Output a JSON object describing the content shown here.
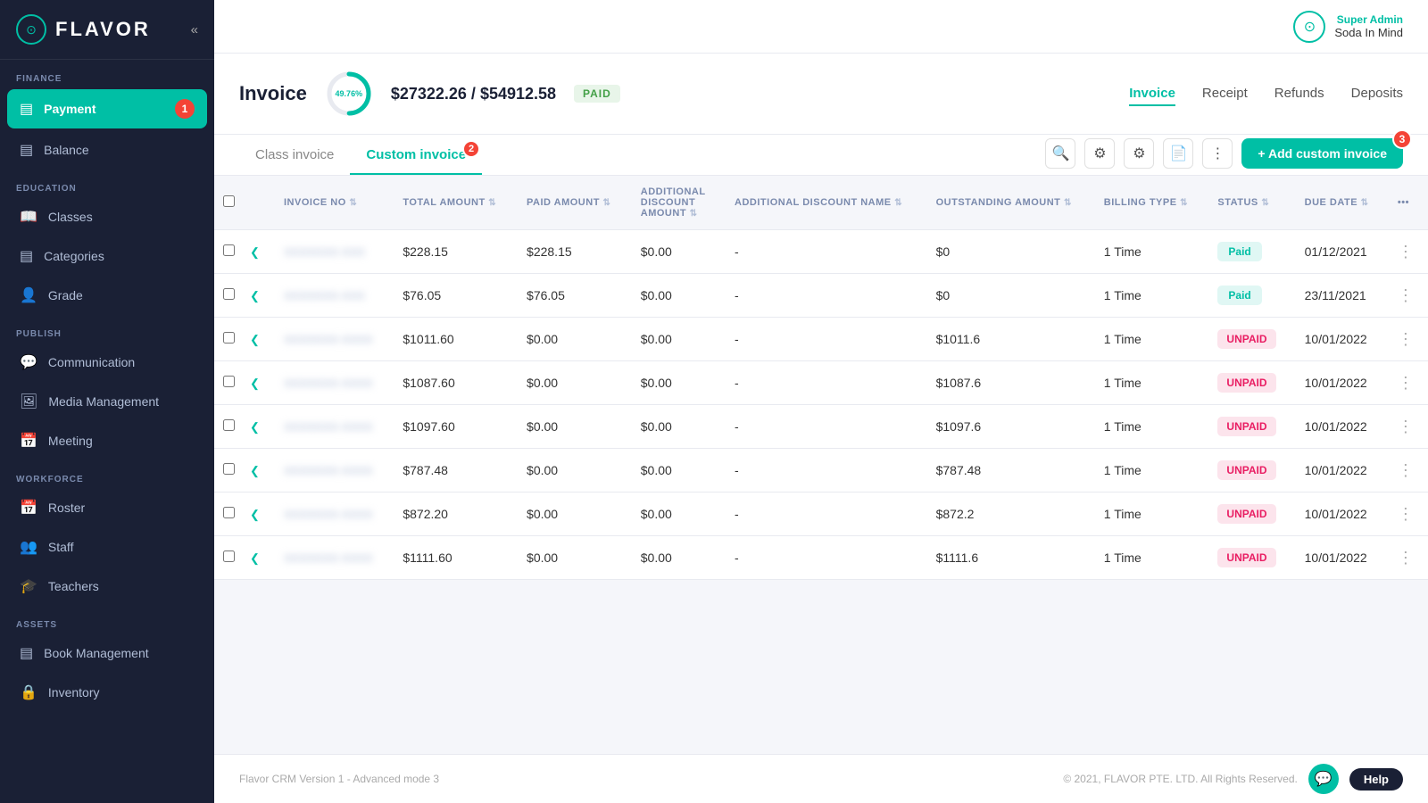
{
  "app": {
    "logo_text": "FLAVOR",
    "chevron": "«"
  },
  "topbar": {
    "role": "Super Admin",
    "name": "Soda In Mind",
    "avatar_icon": "⊙"
  },
  "sidebar": {
    "sections": [
      {
        "label": "FINANCE",
        "items": [
          {
            "id": "payment",
            "icon": "▤",
            "label": "Payment",
            "active": true,
            "badge": "1"
          },
          {
            "id": "balance",
            "icon": "▤",
            "label": "Balance",
            "active": false
          }
        ]
      },
      {
        "label": "EDUCATION",
        "items": [
          {
            "id": "classes",
            "icon": "📖",
            "label": "Classes",
            "active": false
          },
          {
            "id": "categories",
            "icon": "▤",
            "label": "Categories",
            "active": false
          },
          {
            "id": "grade",
            "icon": "👤",
            "label": "Grade",
            "active": false
          }
        ]
      },
      {
        "label": "PUBLISH",
        "items": [
          {
            "id": "communication",
            "icon": "💬",
            "label": "Communication",
            "active": false
          },
          {
            "id": "media",
            "icon": "🖼",
            "label": "Media Management",
            "active": false
          },
          {
            "id": "meeting",
            "icon": "📅",
            "label": "Meeting",
            "active": false
          }
        ]
      },
      {
        "label": "WORKFORCE",
        "items": [
          {
            "id": "roster",
            "icon": "📅",
            "label": "Roster",
            "active": false
          },
          {
            "id": "staff",
            "icon": "👥",
            "label": "Staff",
            "active": false
          },
          {
            "id": "teachers",
            "icon": "🎓",
            "label": "Teachers",
            "active": false
          }
        ]
      },
      {
        "label": "ASSETS",
        "items": [
          {
            "id": "book",
            "icon": "▤",
            "label": "Book Management",
            "active": false
          },
          {
            "id": "inventory",
            "icon": "🔒",
            "label": "Inventory",
            "active": false
          }
        ]
      }
    ]
  },
  "invoice_header": {
    "title": "Invoice",
    "progress_pct": "49.76%",
    "amount_paid": "$27322.26",
    "amount_total": "$54912.58",
    "status": "PAID",
    "tabs": [
      {
        "id": "invoice",
        "label": "Invoice",
        "active": true
      },
      {
        "id": "receipt",
        "label": "Receipt",
        "active": false
      },
      {
        "id": "refunds",
        "label": "Refunds",
        "active": false
      },
      {
        "id": "deposits",
        "label": "Deposits",
        "active": false
      }
    ]
  },
  "subtabs": {
    "items": [
      {
        "id": "class-invoice",
        "label": "Class invoice",
        "active": false
      },
      {
        "id": "custom-invoice",
        "label": "Custom invoice",
        "active": true
      }
    ],
    "add_button_label": "+ Add custom invoice",
    "badge_subtab": "2",
    "badge_add": "3"
  },
  "table": {
    "columns": [
      {
        "id": "checkbox",
        "label": ""
      },
      {
        "id": "expand",
        "label": ""
      },
      {
        "id": "invoice_no",
        "label": "INVOICE NO"
      },
      {
        "id": "total_amount",
        "label": "TOTAL AMOUNT"
      },
      {
        "id": "paid_amount",
        "label": "PAID AMOUNT"
      },
      {
        "id": "additional_discount_amount",
        "label": "ADDITIONAL DISCOUNT AMOUNT"
      },
      {
        "id": "additional_discount_name",
        "label": "ADDITIONAL DISCOUNT NAME"
      },
      {
        "id": "outstanding_amount",
        "label": "OUTSTANDING AMOUNT"
      },
      {
        "id": "billing_type",
        "label": "BILLING TYPE"
      },
      {
        "id": "status",
        "label": "STATUS"
      },
      {
        "id": "due_date",
        "label": "DUE DATE"
      },
      {
        "id": "actions",
        "label": "•••"
      }
    ],
    "rows": [
      {
        "invoice_no": "XXXXXXX-XXX",
        "total_amount": "$228.15",
        "paid_amount": "$228.15",
        "additional_discount_amount": "$0.00",
        "additional_discount_name": "-",
        "outstanding_amount": "$0",
        "billing_type": "1 Time",
        "status": "Paid",
        "status_type": "paid",
        "due_date": "01/12/2021"
      },
      {
        "invoice_no": "XXXXXXX-XXX",
        "total_amount": "$76.05",
        "paid_amount": "$76.05",
        "additional_discount_amount": "$0.00",
        "additional_discount_name": "-",
        "outstanding_amount": "$0",
        "billing_type": "1 Time",
        "status": "Paid",
        "status_type": "paid",
        "due_date": "23/11/2021"
      },
      {
        "invoice_no": "XXXXXXX-XXXX",
        "total_amount": "$1011.60",
        "paid_amount": "$0.00",
        "additional_discount_amount": "$0.00",
        "additional_discount_name": "-",
        "outstanding_amount": "$1011.6",
        "billing_type": "1 Time",
        "status": "UNPAID",
        "status_type": "unpaid",
        "due_date": "10/01/2022"
      },
      {
        "invoice_no": "XXXXXXX-XXXX",
        "total_amount": "$1087.60",
        "paid_amount": "$0.00",
        "additional_discount_amount": "$0.00",
        "additional_discount_name": "-",
        "outstanding_amount": "$1087.6",
        "billing_type": "1 Time",
        "status": "UNPAID",
        "status_type": "unpaid",
        "due_date": "10/01/2022"
      },
      {
        "invoice_no": "XXXXXXX-XXXX",
        "total_amount": "$1097.60",
        "paid_amount": "$0.00",
        "additional_discount_amount": "$0.00",
        "additional_discount_name": "-",
        "outstanding_amount": "$1097.6",
        "billing_type": "1 Time",
        "status": "UNPAID",
        "status_type": "unpaid",
        "due_date": "10/01/2022"
      },
      {
        "invoice_no": "XXXXXXX-XXXX",
        "total_amount": "$787.48",
        "paid_amount": "$0.00",
        "additional_discount_amount": "$0.00",
        "additional_discount_name": "-",
        "outstanding_amount": "$787.48",
        "billing_type": "1 Time",
        "status": "UNPAID",
        "status_type": "unpaid",
        "due_date": "10/01/2022"
      },
      {
        "invoice_no": "XXXXXXX-XXXX",
        "total_amount": "$872.20",
        "paid_amount": "$0.00",
        "additional_discount_amount": "$0.00",
        "additional_discount_name": "-",
        "outstanding_amount": "$872.2",
        "billing_type": "1 Time",
        "status": "UNPAID",
        "status_type": "unpaid",
        "due_date": "10/01/2022"
      },
      {
        "invoice_no": "XXXXXXX-XXXX",
        "total_amount": "$1111.60",
        "paid_amount": "$0.00",
        "additional_discount_amount": "$0.00",
        "additional_discount_name": "-",
        "outstanding_amount": "$1111.6",
        "billing_type": "1 Time",
        "status": "UNPAID",
        "status_type": "unpaid",
        "due_date": "10/01/2022"
      }
    ]
  },
  "footer": {
    "version_text": "Flavor CRM Version 1 - Advanced mode 3",
    "copyright": "© 2021, FLAVOR PTE. LTD. All Rights Reserved.",
    "help_label": "Help",
    "chat_icon": "💬"
  }
}
